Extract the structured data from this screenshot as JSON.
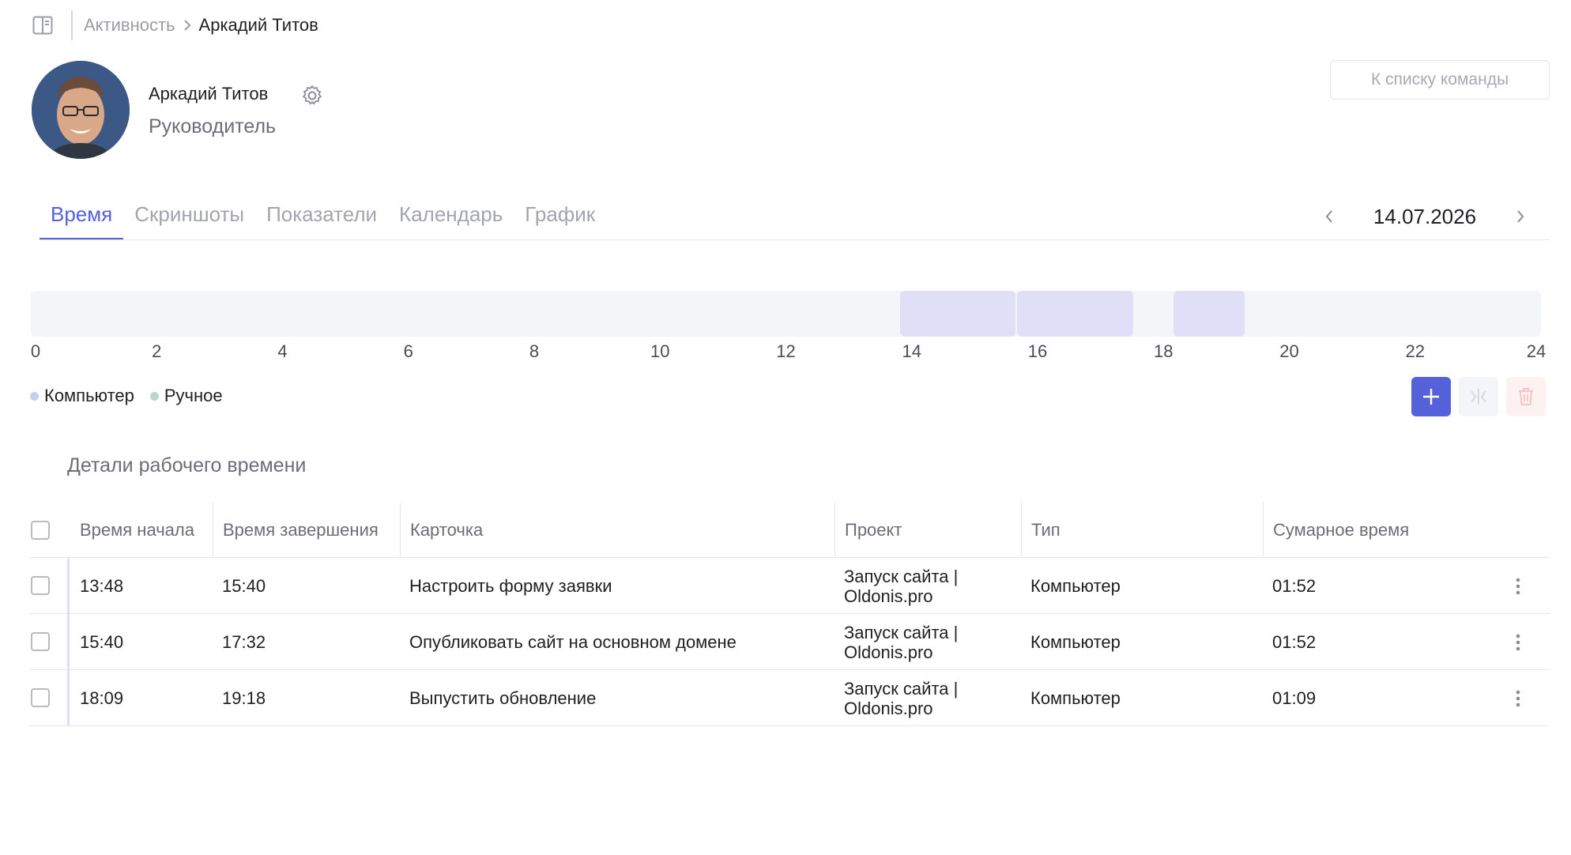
{
  "breadcrumb": {
    "parent": "Активность",
    "current": "Аркадий Титов"
  },
  "profile": {
    "name": "Аркадий Титов",
    "role": "Руководитель"
  },
  "team_button": "К списку команды",
  "tabs": [
    {
      "label": "Время",
      "active": true
    },
    {
      "label": "Скриншоты",
      "active": false
    },
    {
      "label": "Показатели",
      "active": false
    },
    {
      "label": "Календарь",
      "active": false
    },
    {
      "label": "График",
      "active": false
    }
  ],
  "date": "14.07.2026",
  "timeline": {
    "hour_ticks": [
      "0",
      "2",
      "4",
      "6",
      "8",
      "10",
      "12",
      "14",
      "16",
      "18",
      "20",
      "22",
      "24"
    ],
    "segments": [
      {
        "start": "13:48",
        "end": "15:40",
        "type": "computer"
      },
      {
        "start": "15:40",
        "end": "17:32",
        "type": "computer"
      },
      {
        "start": "18:09",
        "end": "19:18",
        "type": "computer"
      }
    ]
  },
  "legend": {
    "computer": "Компьютер",
    "manual": "Ручное"
  },
  "colors": {
    "accent": "#5561d9",
    "computer": "#c9cbf3",
    "manual": "#b7d7cf",
    "segment": "#dfe0f8"
  },
  "section_title": "Детали рабочего времени",
  "table": {
    "headers": {
      "start": "Время начала",
      "end": "Время завершения",
      "card": "Карточка",
      "project": "Проект",
      "type": "Тип",
      "total": "Сумарное время"
    },
    "rows": [
      {
        "start": "13:48",
        "end": "15:40",
        "card": "Настроить форму заявки",
        "project_line1": "Запуск сайта |",
        "project_line2": "Oldonis.pro",
        "type": "Компьютер",
        "total": "01:52"
      },
      {
        "start": "15:40",
        "end": "17:32",
        "card": "Опубликовать сайт на основном домене",
        "project_line1": "Запуск сайта |",
        "project_line2": "Oldonis.pro",
        "type": "Компьютер",
        "total": "01:52"
      },
      {
        "start": "18:09",
        "end": "19:18",
        "card": "Выпустить обновление",
        "project_line1": "Запуск сайта |",
        "project_line2": "Oldonis.pro",
        "type": "Компьютер",
        "total": "01:09"
      }
    ]
  }
}
